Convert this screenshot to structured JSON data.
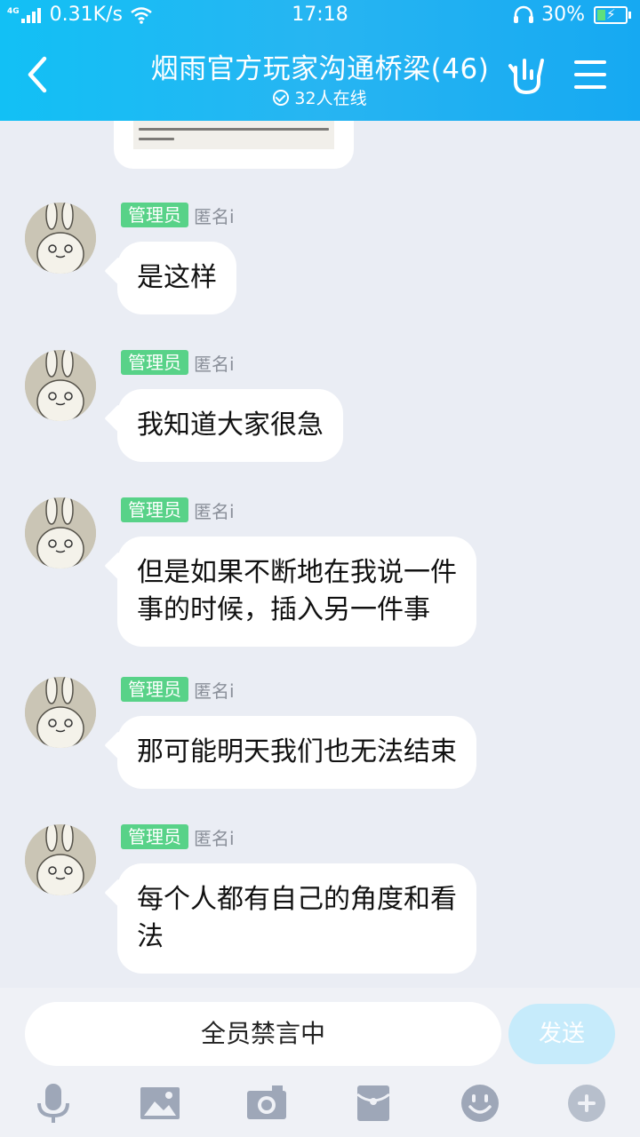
{
  "status_bar": {
    "network": "4G",
    "speed": "0.31K/s",
    "time": "17:18",
    "battery": "30%",
    "battery_level": 0.3
  },
  "header": {
    "title": "烟雨官方玩家沟通桥梁(46)",
    "online": "32人在线"
  },
  "messages": [
    {
      "badge": "管理员",
      "nick": "匿名i",
      "text": "是这样"
    },
    {
      "badge": "管理员",
      "nick": "匿名i",
      "text": "我知道大家很急"
    },
    {
      "badge": "管理员",
      "nick": "匿名i",
      "text": "但是如果不断地在我说一件\n事的时候，插入另一件事"
    },
    {
      "badge": "管理员",
      "nick": "匿名i",
      "text": "那可能明天我们也无法结束"
    },
    {
      "badge": "管理员",
      "nick": "匿名i",
      "text": "每个人都有自己的角度和看\n法"
    }
  ],
  "input": {
    "muted_text": "全员禁言中",
    "send_label": "发送"
  },
  "toolbar": [
    "microphone-icon",
    "image-icon",
    "camera-icon",
    "red-packet-icon",
    "emoji-icon",
    "plus-icon"
  ],
  "colors": {
    "header": "#1fb7f4",
    "badge": "#58d288",
    "background": "#eaedf4"
  }
}
